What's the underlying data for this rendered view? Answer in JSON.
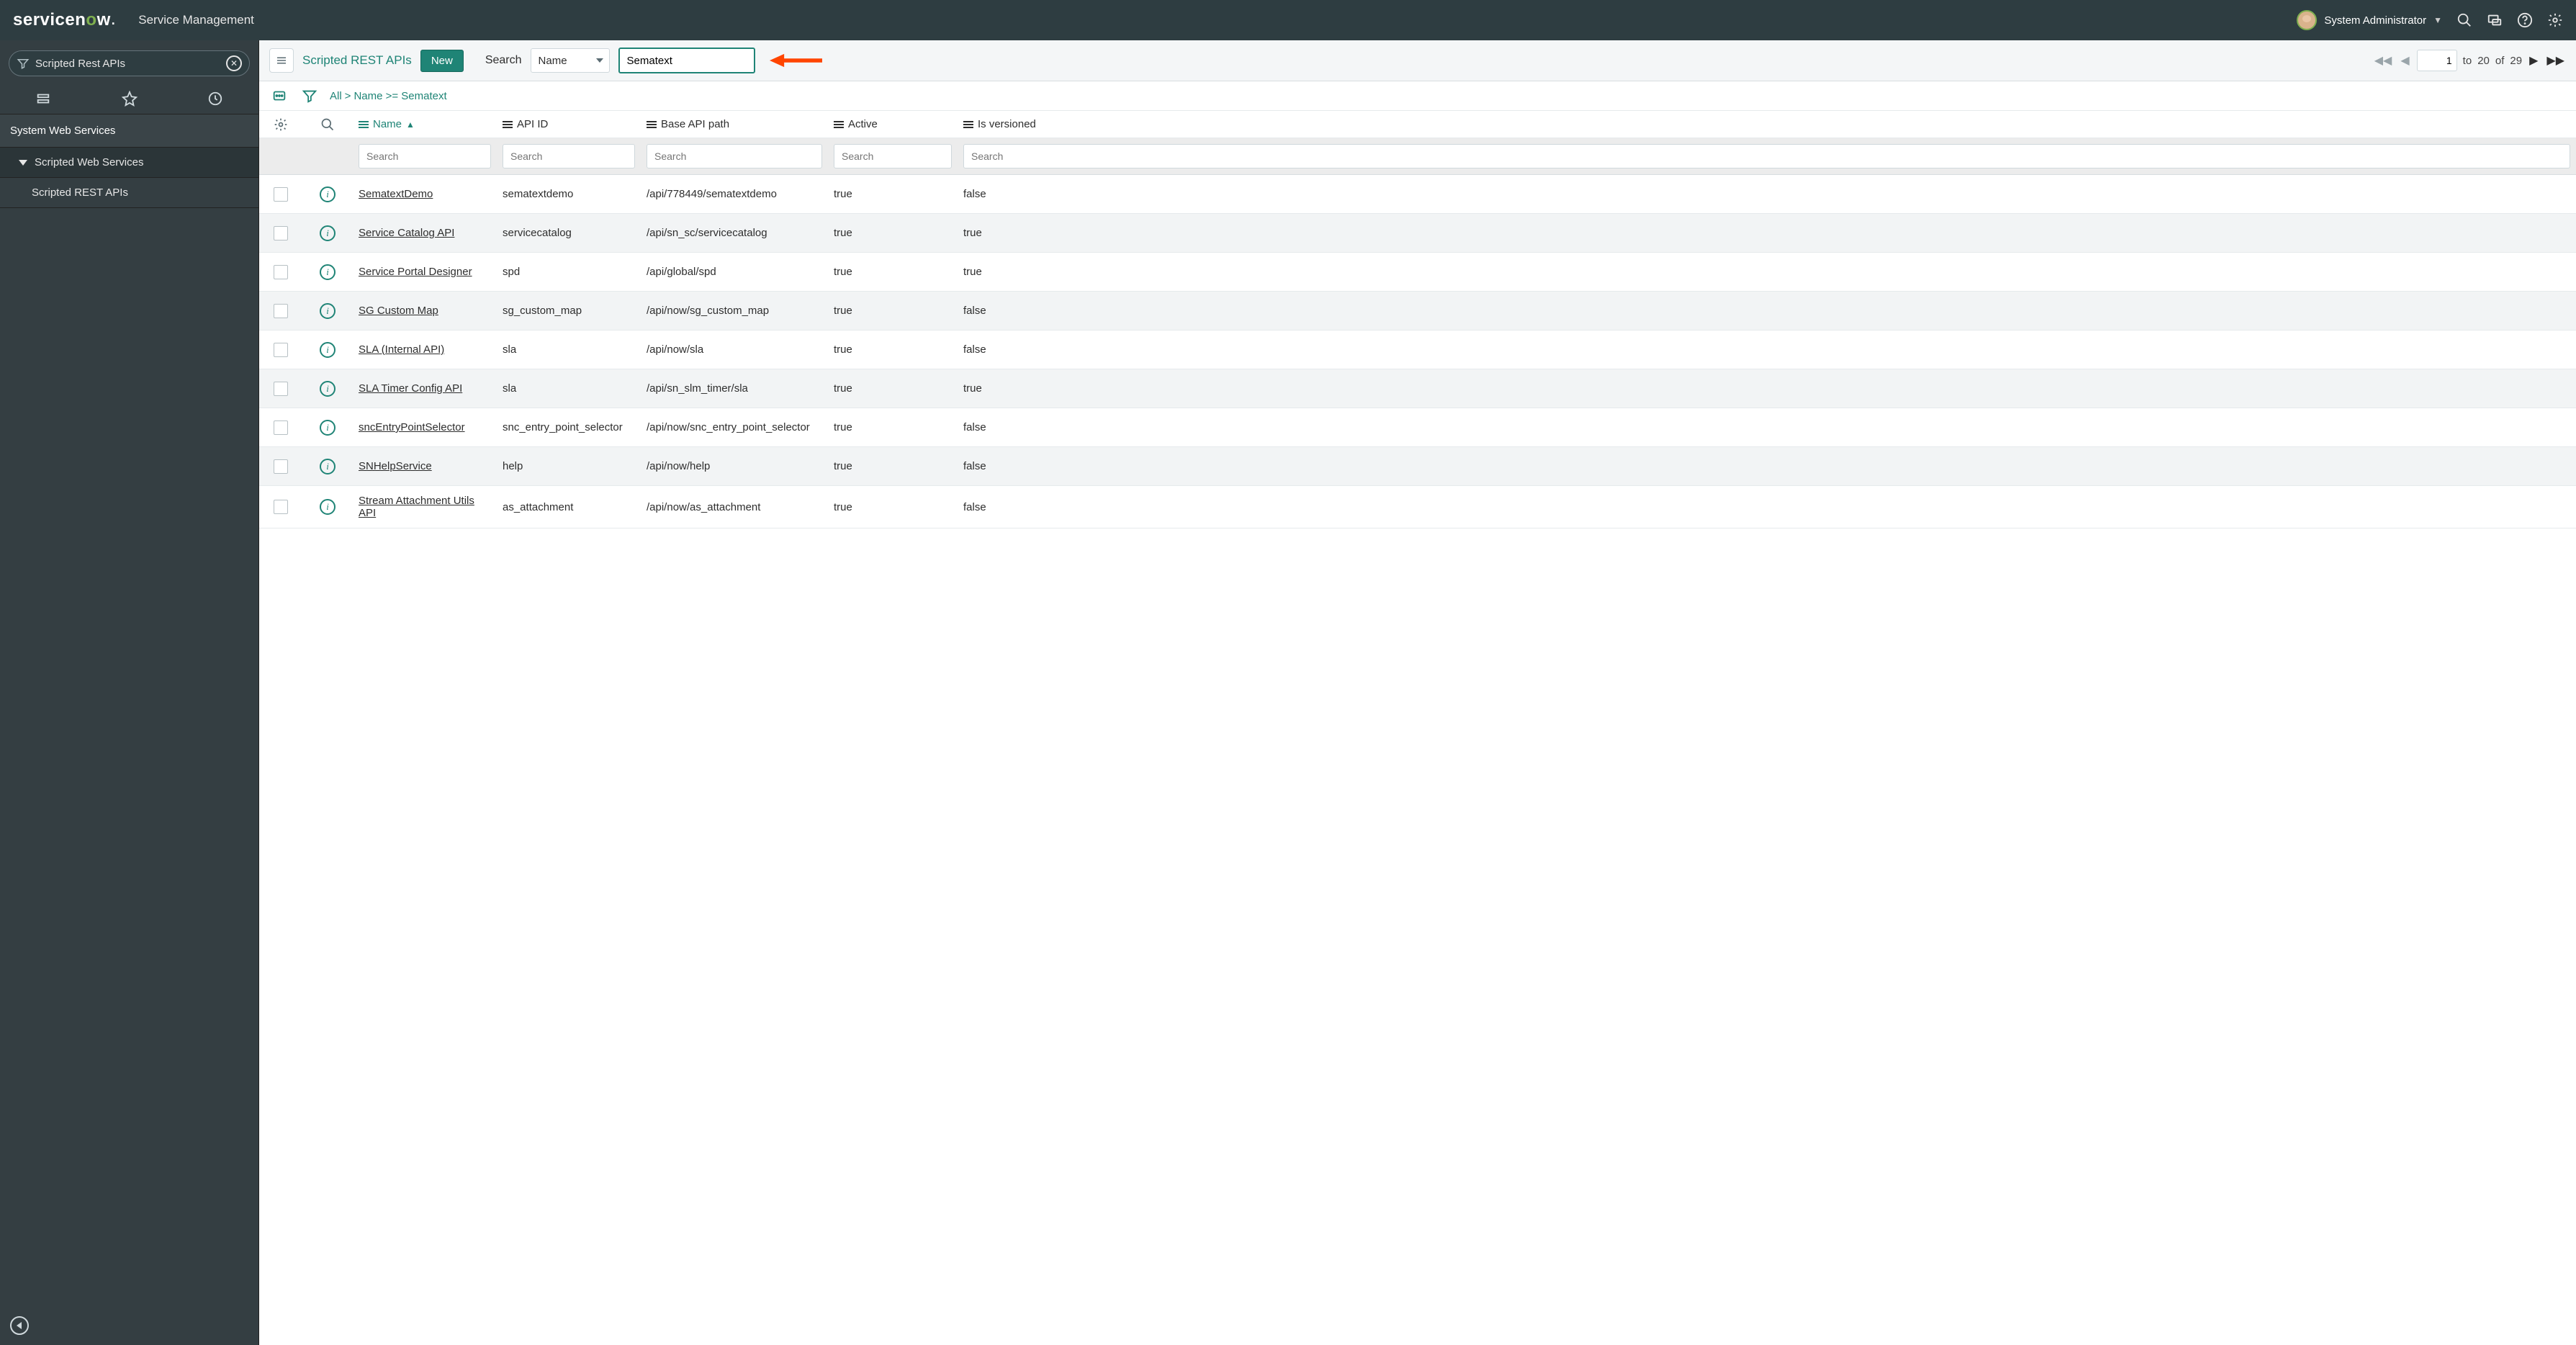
{
  "header": {
    "logo_prefix": "servicen",
    "logo_o": "o",
    "logo_suffix": "w",
    "app_title": "Service Management",
    "user_name": "System Administrator"
  },
  "sidebar": {
    "search_value": "Scripted Rest APIs",
    "section": "System Web Services",
    "group": "Scripted Web Services",
    "item": "Scripted REST APIs"
  },
  "toolbar": {
    "title": "Scripted REST APIs",
    "new_label": "New",
    "search_label": "Search",
    "search_field": "Name",
    "search_value": "Sematext",
    "page": "1",
    "to_label": "to",
    "to_value": "20",
    "of_label": "of",
    "total": "29"
  },
  "breadcrumb": {
    "all": "All",
    "filter": "Name >= Sematext"
  },
  "columns": {
    "name": "Name",
    "api_id": "API ID",
    "base_path": "Base API path",
    "active": "Active",
    "versioned": "Is versioned",
    "search_placeholder": "Search"
  },
  "rows": [
    {
      "name": "SematextDemo",
      "api": "sematextdemo",
      "path": "/api/778449/sematextdemo",
      "active": "true",
      "versioned": "false"
    },
    {
      "name": "Service Catalog API",
      "api": "servicecatalog",
      "path": "/api/sn_sc/servicecatalog",
      "active": "true",
      "versioned": "true"
    },
    {
      "name": "Service Portal Designer",
      "api": "spd",
      "path": "/api/global/spd",
      "active": "true",
      "versioned": "true"
    },
    {
      "name": "SG Custom Map",
      "api": "sg_custom_map",
      "path": "/api/now/sg_custom_map",
      "active": "true",
      "versioned": "false"
    },
    {
      "name": "SLA (Internal API)",
      "api": "sla",
      "path": "/api/now/sla",
      "active": "true",
      "versioned": "false"
    },
    {
      "name": "SLA Timer Config API",
      "api": "sla",
      "path": "/api/sn_slm_timer/sla",
      "active": "true",
      "versioned": "true"
    },
    {
      "name": "sncEntryPointSelector",
      "api": "snc_entry_point_selector",
      "path": "/api/now/snc_entry_point_selector",
      "active": "true",
      "versioned": "false"
    },
    {
      "name": "SNHelpService",
      "api": "help",
      "path": "/api/now/help",
      "active": "true",
      "versioned": "false"
    },
    {
      "name": "Stream Attachment Utils API",
      "api": "as_attachment",
      "path": "/api/now/as_attachment",
      "active": "true",
      "versioned": "false"
    }
  ]
}
